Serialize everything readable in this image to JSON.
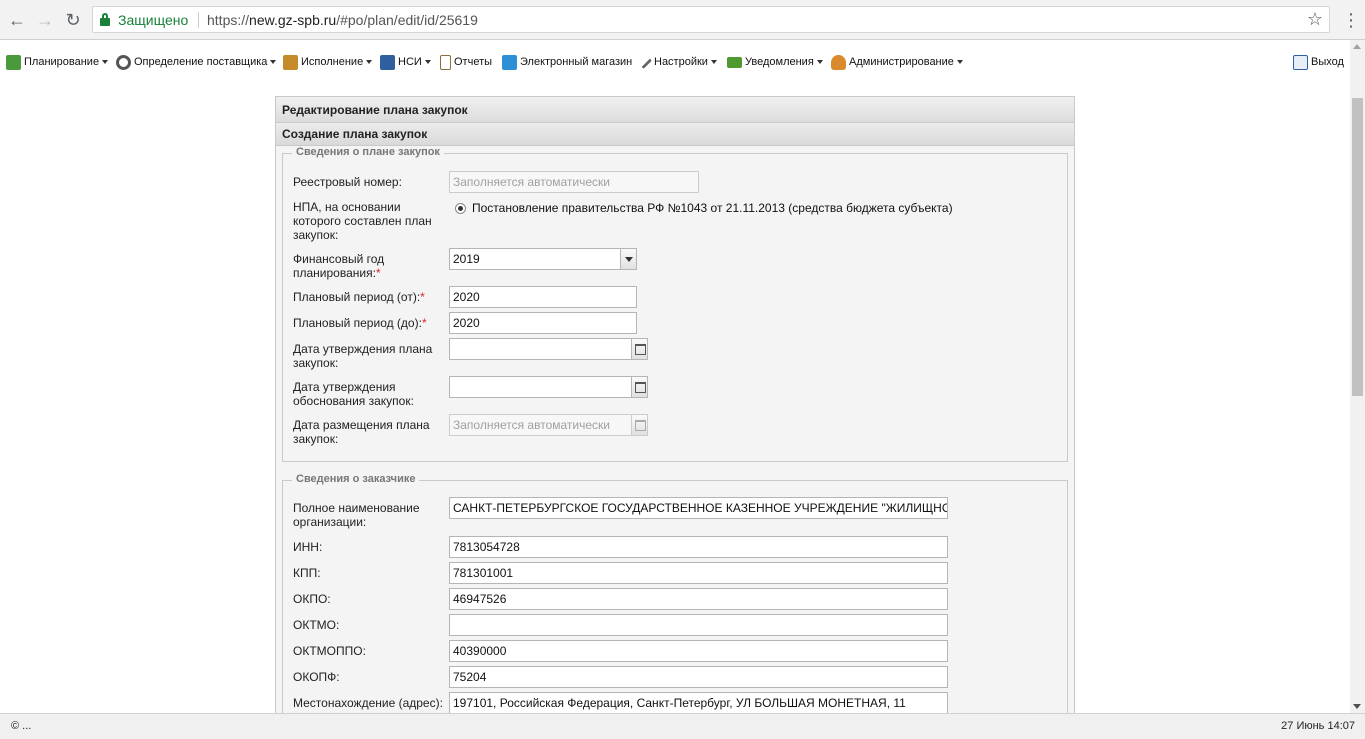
{
  "browser": {
    "security_label": "Защищено",
    "url_scheme": "https://",
    "url_host": "new.gz-spb.ru",
    "url_path": "/#po/plan/edit/id/25619"
  },
  "toolbar": {
    "items": [
      {
        "label": "Планирование",
        "icon": "planning-icon",
        "color": "#4a9a3d",
        "dropdown": true
      },
      {
        "label": "Определение поставщика",
        "icon": "gear-icon",
        "color": "#555555",
        "dropdown": true
      },
      {
        "label": "Исполнение",
        "icon": "execution-icon",
        "color": "#c58b2b",
        "dropdown": true
      },
      {
        "label": "НСИ",
        "icon": "book-icon",
        "color": "#2f5f9e",
        "dropdown": true
      },
      {
        "label": "Отчеты",
        "icon": "report-icon",
        "color": "#8a6d3b",
        "dropdown": false
      },
      {
        "label": "Электронный магазин",
        "icon": "cart-icon",
        "color": "#2d8fd5",
        "dropdown": false
      },
      {
        "label": "Настройки",
        "icon": "wrench-icon",
        "color": "#666666",
        "dropdown": true
      },
      {
        "label": "Уведомления",
        "icon": "notification-icon",
        "color": "#4e9a30",
        "dropdown": true
      },
      {
        "label": "Администрирование",
        "icon": "user-icon",
        "color": "#d88a2c",
        "dropdown": true
      }
    ],
    "exit_label": "Выход"
  },
  "panel": {
    "title": "Редактирование плана закупок",
    "subtitle": "Создание плана закупок"
  },
  "plan_section": {
    "legend": "Сведения о плане закупок",
    "registry_label": "Реестровый номер:",
    "registry_placeholder": "Заполняется автоматически",
    "npa_label": "НПА, на основании которого составлен план закупок:",
    "npa_option": "Постановление правительства РФ №1043 от 21.11.2013 (средства бюджета субъекта)",
    "fin_year_label": "Финансовый год планирования:",
    "fin_year_value": "2019",
    "period_from_label": "Плановый период (от):",
    "period_from_value": "2020",
    "period_to_label": "Плановый период (до):",
    "period_to_value": "2020",
    "approval_date_label": "Дата утверждения плана закупок:",
    "approval_date_value": "",
    "justification_date_label": "Дата утверждения обоснования закупок:",
    "justification_date_value": "",
    "placement_date_label": "Дата размещения плана закупок:",
    "placement_date_placeholder": "Заполняется автоматически",
    "required_mark": "*"
  },
  "customer_section": {
    "legend": "Сведения о заказчике",
    "fields": [
      {
        "label": "Полное наименование организации:",
        "value": "САНКТ-ПЕТЕРБУРГСКОЕ ГОСУДАРСТВЕННОЕ КАЗЕННОЕ УЧРЕЖДЕНИЕ \"ЖИЛИЩНОЕ АГЕ"
      },
      {
        "label": "ИНН:",
        "value": "7813054728"
      },
      {
        "label": "КПП:",
        "value": "781301001"
      },
      {
        "label": "ОКПО:",
        "value": "46947526"
      },
      {
        "label": "ОКТМО:",
        "value": ""
      },
      {
        "label": "ОКТМОППО:",
        "value": "40390000"
      },
      {
        "label": "ОКОПФ:",
        "value": "75204"
      },
      {
        "label": "Местонахождение (адрес):",
        "value": "197101, Российская Федерация, Санкт-Петербург, УЛ БОЛЬШАЯ МОНЕТНАЯ, 11"
      }
    ]
  },
  "status_bar": {
    "left": "© ...",
    "right": "27 Июнь 14:07"
  }
}
